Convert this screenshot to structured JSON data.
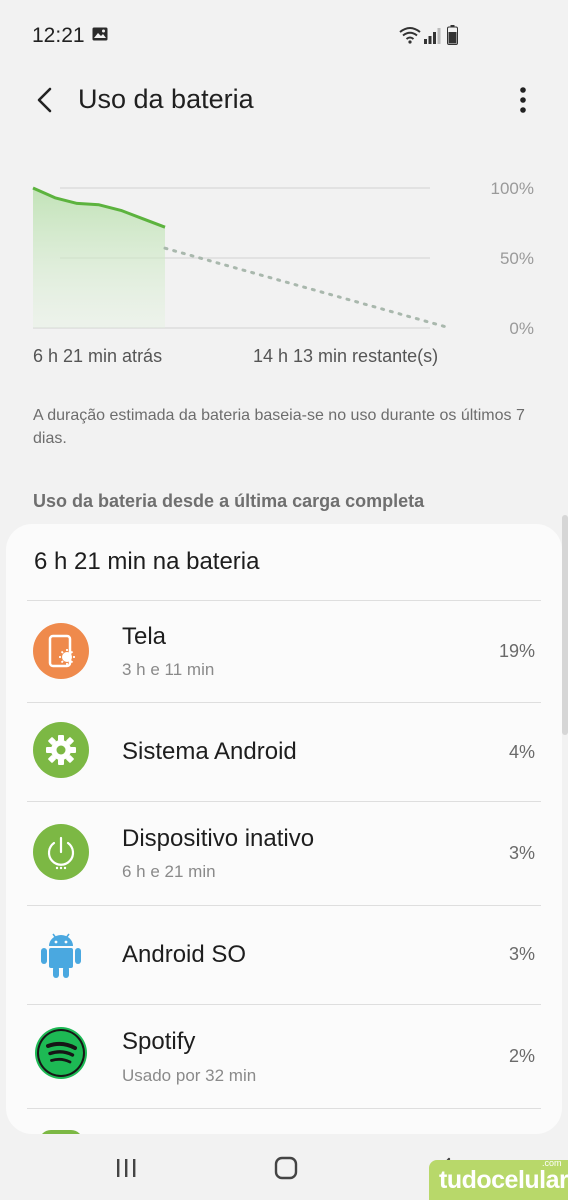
{
  "status_bar": {
    "time": "12:21"
  },
  "app_bar": {
    "title": "Uso da bateria"
  },
  "chart_data": {
    "type": "line",
    "x_labels": [
      "6 h 21 min atrás",
      "14 h 13 min restante(s)"
    ],
    "y_ticks": [
      "100%",
      "50%",
      "0%"
    ],
    "ylim": [
      0,
      100
    ],
    "series": [
      {
        "values": [
          100,
          93,
          89,
          88,
          84,
          78,
          72
        ]
      },
      {
        "values": [
          57,
          0
        ]
      }
    ]
  },
  "note": "A duração estimada da bateria baseia-se no uso durante os últimos 7 dias.",
  "section_header": "Uso da bateria desde a última carga completa",
  "card": {
    "title": "6 h 21 min na bateria",
    "items": [
      {
        "name": "Tela",
        "sub": "3 h e 11 min",
        "percent": "19%",
        "icon": "screen-brightness-icon",
        "color": "#ef8a4c"
      },
      {
        "name": "Sistema Android",
        "sub": "",
        "percent": "4%",
        "icon": "gear-icon",
        "color": "#7cb844"
      },
      {
        "name": "Dispositivo inativo",
        "sub": "6 h e 21 min",
        "percent": "3%",
        "icon": "power-icon",
        "color": "#7cb844"
      },
      {
        "name": "Android SO",
        "sub": "",
        "percent": "3%",
        "icon": "android-icon",
        "color": "#4aa8e0"
      },
      {
        "name": "Spotify",
        "sub": "Usado por 32 min",
        "percent": "2%",
        "icon": "spotify-icon",
        "color": "#1db954"
      }
    ]
  },
  "watermark": {
    "text": "tudocelular",
    "suffix": ".com"
  }
}
